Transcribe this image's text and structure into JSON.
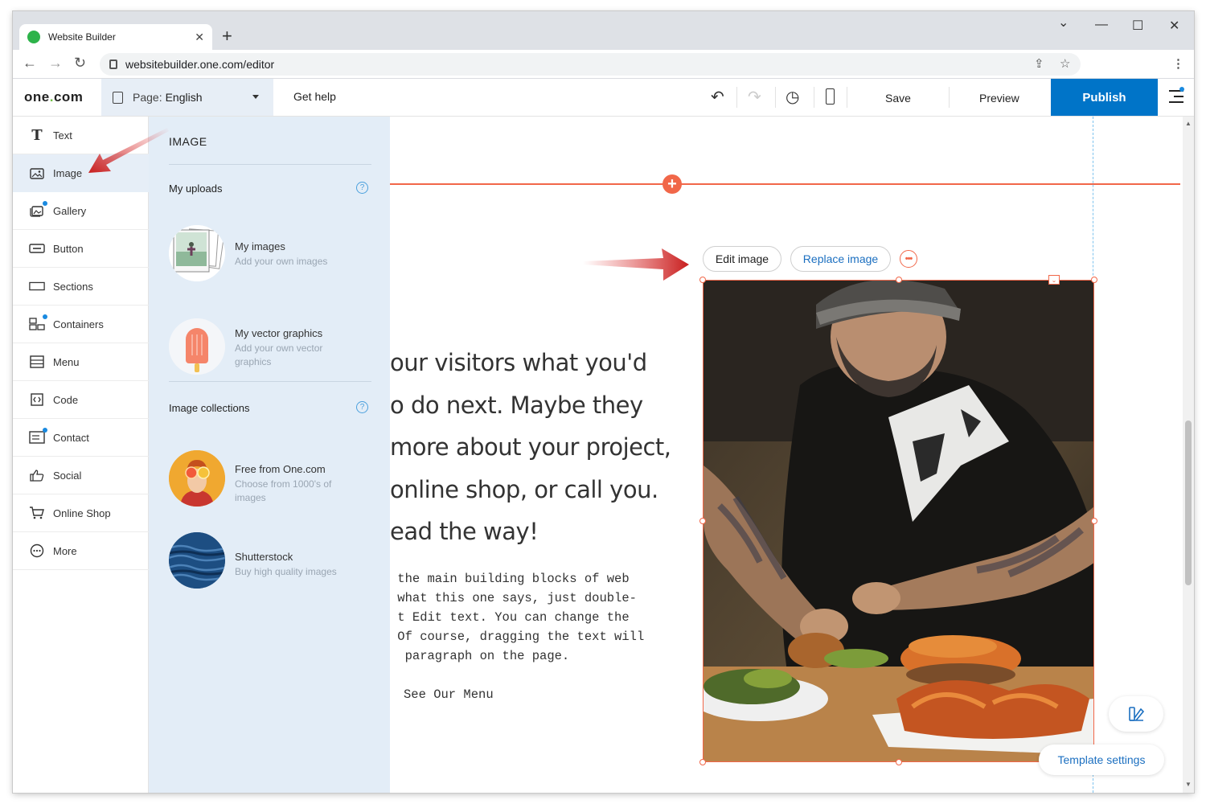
{
  "browser": {
    "tab_title": "Website Builder",
    "tab_close": "✕",
    "new_tab": "+",
    "url": "websitebuilder.one.com/editor",
    "window_controls": {
      "dropdown": "⌄",
      "minimize": "—",
      "maximize": "☐",
      "close": "✕"
    }
  },
  "header": {
    "logo_a": "one",
    "logo_dot": ".",
    "logo_b": "com",
    "page_label": "Page:",
    "page_value": "English",
    "get_help": "Get help",
    "save": "Save",
    "preview": "Preview",
    "publish": "Publish",
    "accent": "#0074c8"
  },
  "sidebar": {
    "items": [
      {
        "label": "Text",
        "icon": "text-icon"
      },
      {
        "label": "Image",
        "icon": "image-icon"
      },
      {
        "label": "Gallery",
        "icon": "gallery-icon"
      },
      {
        "label": "Button",
        "icon": "button-icon"
      },
      {
        "label": "Sections",
        "icon": "sections-icon"
      },
      {
        "label": "Containers",
        "icon": "containers-icon"
      },
      {
        "label": "Menu",
        "icon": "menu-icon"
      },
      {
        "label": "Code",
        "icon": "code-icon"
      },
      {
        "label": "Contact",
        "icon": "contact-icon"
      },
      {
        "label": "Social",
        "icon": "thumbs-up-icon"
      },
      {
        "label": "Online Shop",
        "icon": "cart-icon"
      },
      {
        "label": "More",
        "icon": "more-icon"
      }
    ],
    "active": "Image"
  },
  "panel": {
    "title": "IMAGE",
    "uploads_title": "My uploads",
    "collections_title": "Image collections",
    "help": "?",
    "items": [
      {
        "name": "My images",
        "desc": "Add your own images"
      },
      {
        "name": "My vector graphics",
        "desc": "Add your own vector graphics"
      },
      {
        "name": "Free from One.com",
        "desc": "Choose from 1000's of images"
      },
      {
        "name": "Shutterstock",
        "desc": "Buy high quality images"
      }
    ]
  },
  "canvas": {
    "heading": "our visitors what you'd\no do next. Maybe they\nmore about your project,\nonline shop, or call you.\nead the way!",
    "body": " the main building blocks of web\n what this one says, just double-\n t Edit text. You can change the\n Of course, dragging the text will\n  paragraph on the page.",
    "menu_link": "See Our Menu",
    "edit_image": "Edit image",
    "replace_image": "Replace image",
    "more": "•••",
    "accent": "#f16749"
  },
  "floating": {
    "template_settings": "Template settings"
  }
}
